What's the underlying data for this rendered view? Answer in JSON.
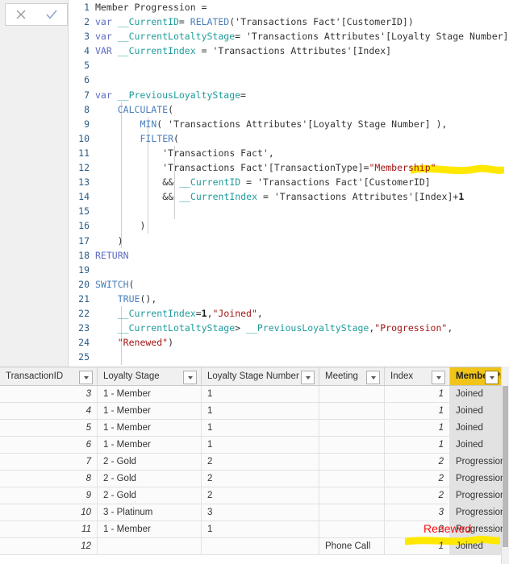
{
  "toolbar": {
    "cancel_icon": "x-icon",
    "cancel_label": "✕",
    "confirm_icon": "check-icon",
    "confirm_label": "✓"
  },
  "editor": {
    "measure_name": "Member Progression",
    "language": "DAX",
    "line_count": 25,
    "lines": [
      {
        "n": "1",
        "text": "Member Progression ="
      },
      {
        "n": "2",
        "text": "var __CurrentID= RELATED('Transactions Fact'[CustomerID])"
      },
      {
        "n": "3",
        "text": "var __CurrentLotaltyStage= 'Transactions Attributes'[Loyalty Stage Number]"
      },
      {
        "n": "4",
        "text": "VAR __CurrentIndex = 'Transactions Attributes'[Index]"
      },
      {
        "n": "5",
        "text": ""
      },
      {
        "n": "6",
        "text": ""
      },
      {
        "n": "7",
        "text": "var __PreviousLoyaltyStage="
      },
      {
        "n": "8",
        "text": "    CALCULATE("
      },
      {
        "n": "9",
        "text": "        MIN( 'Transactions Attributes'[Loyalty Stage Number] ),"
      },
      {
        "n": "10",
        "text": "        FILTER("
      },
      {
        "n": "11",
        "text": "            'Transactions Fact',"
      },
      {
        "n": "12",
        "text": "            'Transactions Fact'[TransactionType]=\"Membership\""
      },
      {
        "n": "13",
        "text": "            && __CurrentID = 'Transactions Fact'[CustomerID]"
      },
      {
        "n": "14",
        "text": "            && __CurrentIndex = 'Transactions Attributes'[Index]+1"
      },
      {
        "n": "15",
        "text": ""
      },
      {
        "n": "16",
        "text": "        )"
      },
      {
        "n": "17",
        "text": "    )"
      },
      {
        "n": "18",
        "text": "RETURN"
      },
      {
        "n": "19",
        "text": ""
      },
      {
        "n": "20",
        "text": "SWITCH("
      },
      {
        "n": "21",
        "text": "    TRUE(),"
      },
      {
        "n": "22",
        "text": "    __CurrentIndex=1,\"Joined\","
      },
      {
        "n": "23",
        "text": "    __CurrentLotaltyStage> __PreviousLoyaltyStage,\"Progression\","
      },
      {
        "n": "24",
        "text": "    \"Renewed\")"
      },
      {
        "n": "25",
        "text": ""
      }
    ]
  },
  "annotations": {
    "highlight_color": "#ffe800",
    "code_highlight_target": "\"Membership\"",
    "renewed_label": "Renewed",
    "renewed_color": "#fc0c0c",
    "table_highlight_target": "Joined"
  },
  "table": {
    "accent_column": "Member Progression",
    "accent_color": "#f0c419",
    "columns": [
      {
        "label": "TransactionID",
        "align": "right",
        "accent": false
      },
      {
        "label": "Loyalty Stage",
        "align": "left",
        "accent": false
      },
      {
        "label": "Loyalty Stage Number",
        "align": "left",
        "accent": false
      },
      {
        "label": "Meeting",
        "align": "left",
        "accent": false
      },
      {
        "label": "Index",
        "align": "right",
        "accent": false
      },
      {
        "label": "Member Progression",
        "align": "left",
        "accent": true
      }
    ],
    "rows": [
      {
        "transaction_id": "3",
        "loyalty_stage": "1 - Member",
        "loyalty_stage_number": "1",
        "meeting": "",
        "index": "1",
        "member_progression": "Joined"
      },
      {
        "transaction_id": "4",
        "loyalty_stage": "1 - Member",
        "loyalty_stage_number": "1",
        "meeting": "",
        "index": "1",
        "member_progression": "Joined"
      },
      {
        "transaction_id": "5",
        "loyalty_stage": "1 - Member",
        "loyalty_stage_number": "1",
        "meeting": "",
        "index": "1",
        "member_progression": "Joined"
      },
      {
        "transaction_id": "6",
        "loyalty_stage": "1 - Member",
        "loyalty_stage_number": "1",
        "meeting": "",
        "index": "1",
        "member_progression": "Joined"
      },
      {
        "transaction_id": "7",
        "loyalty_stage": "2 - Gold",
        "loyalty_stage_number": "2",
        "meeting": "",
        "index": "2",
        "member_progression": "Progression"
      },
      {
        "transaction_id": "8",
        "loyalty_stage": "2 - Gold",
        "loyalty_stage_number": "2",
        "meeting": "",
        "index": "2",
        "member_progression": "Progression"
      },
      {
        "transaction_id": "9",
        "loyalty_stage": "2 - Gold",
        "loyalty_stage_number": "2",
        "meeting": "",
        "index": "2",
        "member_progression": "Progression"
      },
      {
        "transaction_id": "10",
        "loyalty_stage": "3 - Platinum",
        "loyalty_stage_number": "3",
        "meeting": "",
        "index": "3",
        "member_progression": "Progression"
      },
      {
        "transaction_id": "11",
        "loyalty_stage": "1 - Member",
        "loyalty_stage_number": "1",
        "meeting": "",
        "index": "2",
        "member_progression": "Progression"
      },
      {
        "transaction_id": "12",
        "loyalty_stage": "",
        "loyalty_stage_number": "",
        "meeting": "Phone Call",
        "index": "1",
        "member_progression": "Joined"
      }
    ]
  }
}
